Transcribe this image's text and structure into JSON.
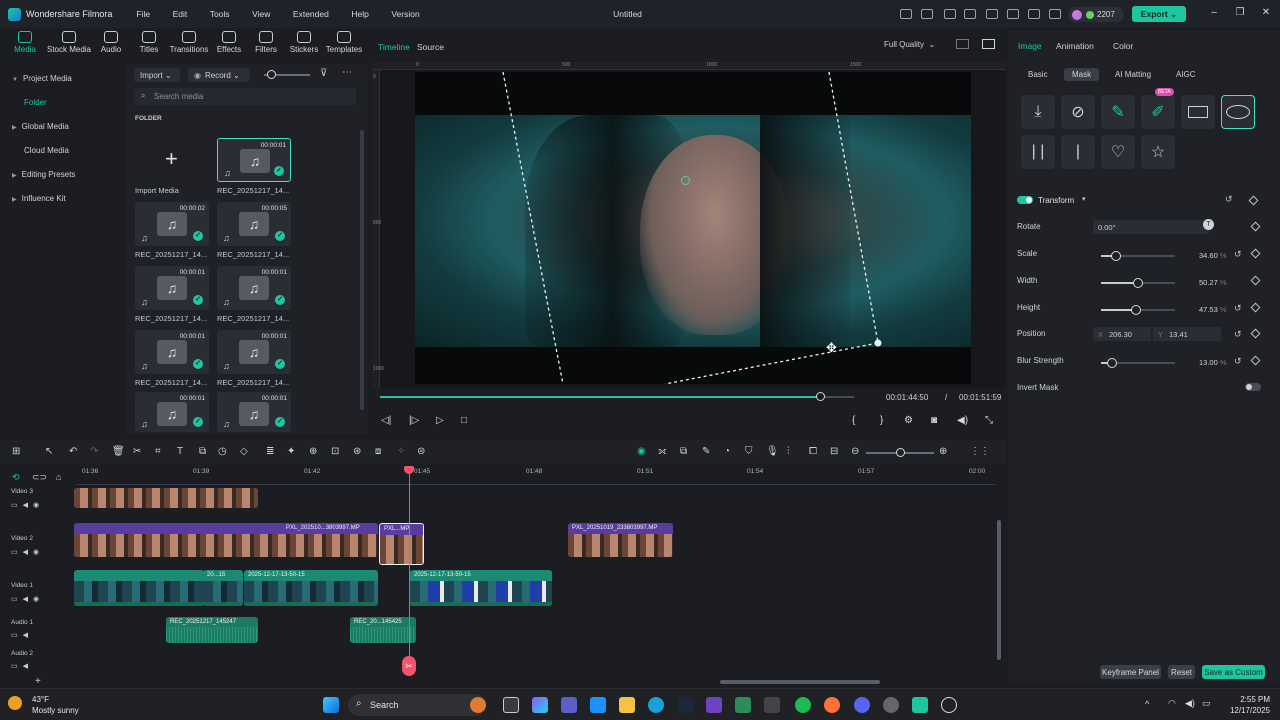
{
  "app": {
    "name": "Wondershare Filmora",
    "title": "Untitled",
    "credits": "2207",
    "export_label": "Export"
  },
  "menu": [
    "File",
    "Edit",
    "Tools",
    "View",
    "Extended",
    "Help",
    "Version"
  ],
  "media_tabs": [
    "Media",
    "Stock Media",
    "Audio",
    "Titles",
    "Transitions",
    "Effects",
    "Filters",
    "Stickers",
    "Templates"
  ],
  "sidebar": {
    "items": [
      "Project Media",
      "Folder",
      "Global Media",
      "Cloud Media",
      "Editing Presets",
      "Influence Kit"
    ]
  },
  "browser": {
    "import_label": "Import",
    "record_label": "Record",
    "search_placeholder": "Search media",
    "folder_label": "FOLDER",
    "import_media_label": "Import Media",
    "tiles": [
      {
        "dur": "00:00:01",
        "name": "REC_20251217_14..."
      },
      {
        "dur": "00:00:02",
        "name": "REC_20251217_14..."
      },
      {
        "dur": "00:00:05",
        "name": "REC_20251217_14..."
      },
      {
        "dur": "00:00:01",
        "name": "REC_20251217_14..."
      },
      {
        "dur": "00:00:01",
        "name": "REC_20251217_14..."
      },
      {
        "dur": "00:00:01",
        "name": "REC_20251217_14..."
      },
      {
        "dur": "00:00:01",
        "name": "REC_20251217_14..."
      },
      {
        "dur": "00:00:01",
        "name": ""
      },
      {
        "dur": "00:00:01",
        "name": ""
      }
    ]
  },
  "preview": {
    "tab_timeline": "Timeline",
    "tab_source": "Source",
    "quality": "Full Quality",
    "current_time": "00:01:44:50",
    "separator": "/",
    "total_time": "00:01:51:59",
    "progress": 0.93,
    "ruler_h": [
      "0",
      "500",
      "1000",
      "1500"
    ],
    "ruler_v": [
      "0",
      "500",
      "1000"
    ]
  },
  "right": {
    "tabs": [
      "Image",
      "Animation",
      "Color"
    ],
    "subtabs": [
      "Basic",
      "Mask",
      "AI Matting",
      "AIGC"
    ],
    "beta": "BETA",
    "transform_label": "Transform",
    "rotate_label": "Rotate",
    "rotate_value": "0.00°",
    "props": [
      {
        "label": "Scale",
        "value": "34.60",
        "unit": "%",
        "pct": 0.2
      },
      {
        "label": "Width",
        "value": "50.27",
        "unit": "%",
        "pct": 0.5
      },
      {
        "label": "Height",
        "value": "47.53",
        "unit": "%",
        "pct": 0.47
      },
      {
        "label": "Blur Strength",
        "value": "13.00",
        "unit": "%",
        "pct": 0.15
      }
    ],
    "position_label": "Position",
    "pos_x_label": "X",
    "pos_x": "206.30",
    "pos_y_label": "Y",
    "pos_y": "13.41",
    "invert_label": "Invert Mask",
    "keyframe_label": "Keyframe Panel",
    "reset_label": "Reset",
    "save_label": "Save as Custom"
  },
  "timeline": {
    "ticks": [
      "01:36",
      "01:39",
      "01:42",
      "01:45",
      "01:48",
      "01:51",
      "01:54",
      "01:57",
      "02:00"
    ],
    "tracks": [
      "Video 3",
      "Video 2",
      "Video 1",
      "Audio 1",
      "Audio 2"
    ],
    "clips": {
      "v2a": "PXL_202510...3803997.MP",
      "v2b": "PXL...MP",
      "v2c": "PXL_20251019_233803997.MP",
      "v1a": "20...15",
      "v1b": "2025-12-17-13-50-15",
      "v1c": "2025-12-17-13-50-15",
      "a1a": "REC_20251217_145247",
      "a1b": "REC_20...145425"
    }
  },
  "taskbar": {
    "temp": "43°F",
    "weather": "Mostly sunny",
    "search": "Search",
    "time": "2:55 PM",
    "date": "12/17/2025"
  }
}
